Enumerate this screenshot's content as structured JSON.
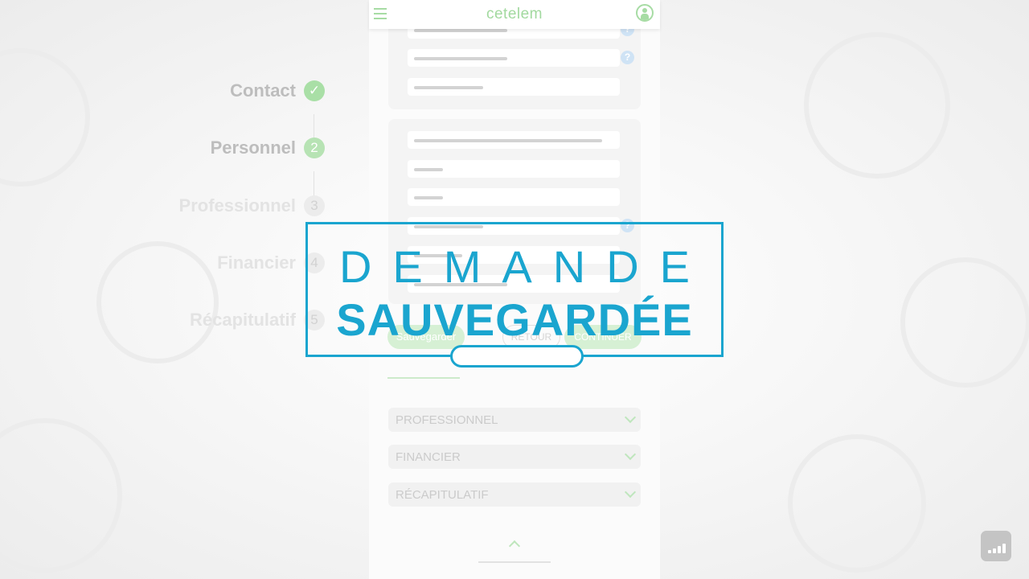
{
  "brand": "cetelem",
  "steps": [
    {
      "label": "Contact",
      "badge": "✓",
      "state": "done"
    },
    {
      "label": "Personnel",
      "badge": "2",
      "state": "current"
    },
    {
      "label": "Professionnel",
      "badge": "3",
      "state": "todo"
    },
    {
      "label": "Financier",
      "badge": "4",
      "state": "todo"
    },
    {
      "label": "Récapitulatif",
      "badge": "5",
      "state": "todo"
    }
  ],
  "buttons": {
    "save": "Sauvegarder",
    "back": "RETOUR",
    "continue": "CONTINUER"
  },
  "accordion": [
    "PROFESSIONNEL",
    "FINANCIER",
    "RÉCAPITULATIF"
  ],
  "help_glyph": "?",
  "overlay": {
    "line1": "DEMANDE",
    "line2": "SAUVEGARDÉE"
  },
  "colors": {
    "accent_green": "#a9dfa6",
    "overlay_blue": "#1aa5cf"
  },
  "icons": {
    "menu": "hamburger-menu-icon",
    "account": "user-account-icon",
    "help": "question-mark-icon",
    "chevron": "chevron-down-icon",
    "scroll_top": "chevron-up-icon",
    "signal": "signal-bars-icon"
  }
}
